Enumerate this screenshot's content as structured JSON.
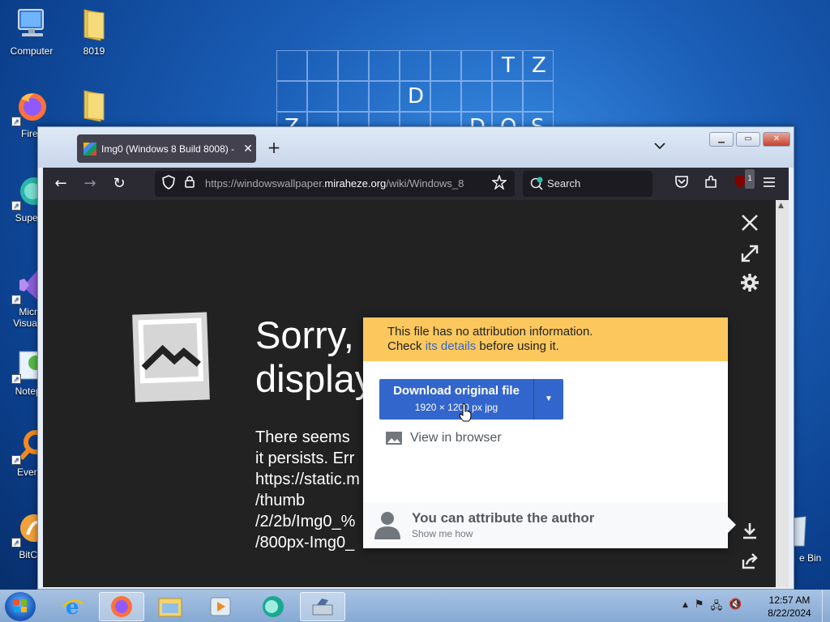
{
  "desktop": {
    "icons": [
      {
        "label": "Computer"
      },
      {
        "label": "8019"
      },
      {
        "label": "Firef"
      },
      {
        "label": "Supern"
      },
      {
        "label": "Micro\nVisual S"
      },
      {
        "label": "Notepa"
      },
      {
        "label": "Everyt"
      },
      {
        "label": "BitCo"
      }
    ],
    "recycle_bin_label": "e Bin",
    "wallpaper_letters": [
      "T",
      "Z",
      "D",
      "Z",
      "D",
      "O",
      "S"
    ]
  },
  "browser": {
    "tab": {
      "title": "Img0 (Windows 8 Build 8008) -",
      "close_glyph": "✕"
    },
    "new_tab_glyph": "+",
    "list_tabs_glyph": "⌄",
    "caption": {
      "minimize": "▁",
      "maximize": "▭",
      "close": "✕"
    },
    "nav": {
      "back": "←",
      "forward": "→",
      "reload": "↻"
    },
    "url": {
      "host": "https://windowswallpaper.",
      "domain": "miraheze.org",
      "path": "/wiki/Windows_8"
    },
    "search_placeholder": "Search",
    "extension_badge": "1"
  },
  "viewer": {
    "controls": {
      "close": "✕",
      "fullscreen": "⤢",
      "settings": "⚙",
      "download": "⤓",
      "share": "⇪"
    },
    "error_heading_line1": "Sorry,",
    "error_heading_line2": "display",
    "error_body": "There seems \nit persists. Err\nhttps://static.m\n/thumb\n/2/2b/Img0_%\n/800px-Img0_"
  },
  "popup": {
    "warning_line1": "This file has no attribution information.",
    "warning_line2_prefix": "Check ",
    "warning_link": "its details",
    "warning_line2_suffix": " before using it.",
    "download_title": "Download original file",
    "download_sub": "1920 × 1200 px jpg",
    "download_arrow": "▼",
    "view_in_browser": "View in browser",
    "attrib_title": "You can attribute the author",
    "attrib_sub": "Show me how"
  },
  "taskbar": {
    "clock_time": "12:57 AM",
    "clock_date": "8/22/2024",
    "tray_glyphs": [
      "▲",
      "⚑",
      "🖧",
      "🔇"
    ]
  },
  "colors": {
    "popup_warning_bg": "#fcc85d",
    "download_button": "#3366cc",
    "link": "#3366cc",
    "viewer_bg": "#222222",
    "firefox_toolbar": "#2b2a33"
  }
}
